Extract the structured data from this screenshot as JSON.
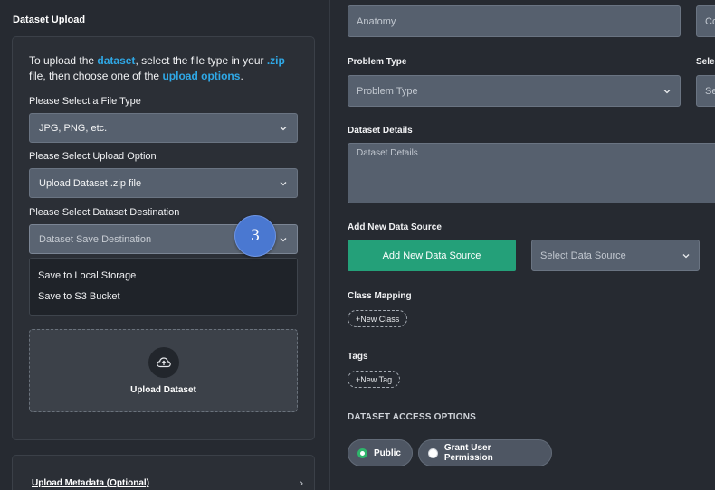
{
  "left": {
    "title": "Dataset Upload",
    "intro": {
      "part1": "To upload the ",
      "hl1": "dataset",
      "part2": ", select the file type in your ",
      "hl2": ".zip",
      "part3": " file, then choose one of the ",
      "hl3": "upload options",
      "part4": "."
    },
    "file_type_label": "Please Select a File Type",
    "file_type_value": "JPG, PNG, etc.",
    "upload_option_label": "Please Select Upload Option",
    "upload_option_value": "Upload Dataset .zip file",
    "destination_label": "Please Select Dataset Destination",
    "destination_placeholder": "Dataset Save Destination",
    "destination_options": [
      "Save to Local Storage",
      "Save to S3 Bucket"
    ],
    "step_marker": "3",
    "upload_label": "Upload Dataset",
    "metadata_label": "Upload Metadata (Optional)",
    "metadata_chevron": "›"
  },
  "right": {
    "anatomy_placeholder": "Anatomy",
    "cut_field_text": "Co",
    "problem_type_label": "Problem Type",
    "problem_type_placeholder": "Problem Type",
    "cut_label": "Sele",
    "cut_select_text": "Se",
    "dataset_details_label": "Dataset Details",
    "dataset_details_placeholder": "Dataset Details",
    "add_source_label": "Add New Data Source",
    "add_source_button": "Add New Data Source",
    "select_source_placeholder": "Select Data Source",
    "class_mapping_label": "Class Mapping",
    "new_class_chip": "+New Class",
    "tags_label": "Tags",
    "new_tag_chip": "+New Tag",
    "access_title": "DATASET ACCESS OPTIONS",
    "access_options": [
      {
        "label": "Public",
        "selected": true
      },
      {
        "label": "Grant User Permission",
        "selected": false
      }
    ]
  },
  "colors": {
    "accent_blue": "#2fa8e6",
    "primary_green": "#24a079",
    "radio_green": "#2fb56b",
    "marker_blue": "#4a78d1"
  }
}
